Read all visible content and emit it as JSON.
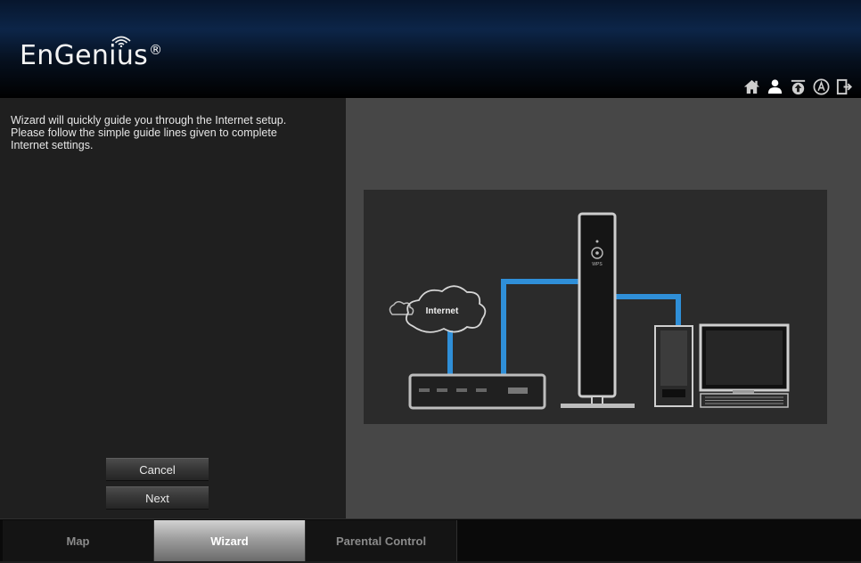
{
  "brand": {
    "name": "EnGenius",
    "trademark": "®"
  },
  "toolbar": {
    "icons": [
      "home-icon",
      "user-icon",
      "upload-icon",
      "language-icon",
      "logout-icon"
    ]
  },
  "wizard": {
    "intro_line1": "Wizard will quickly guide you through the Internet setup.",
    "intro_line2": "Please follow the simple guide lines given to complete",
    "intro_line3": "Internet settings.",
    "cancel_label": "Cancel",
    "next_label": "Next"
  },
  "diagram": {
    "cloud_label": "Internet",
    "wps_label": "WPS",
    "cable_color": "#2f8fd8"
  },
  "tabs": [
    {
      "label": "Map",
      "active": false
    },
    {
      "label": "Wizard",
      "active": true
    },
    {
      "label": "Parental Control",
      "active": false
    }
  ]
}
